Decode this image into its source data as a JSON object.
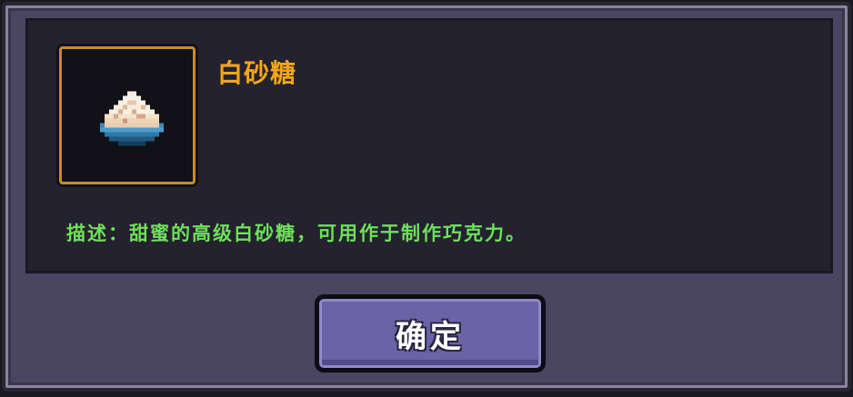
{
  "dialog": {
    "item": {
      "icon": "white-sugar-icon",
      "name": "白砂糖",
      "description": "描述：甜蜜的高级白砂糖，可用作于制作巧克力。"
    },
    "confirm_label": "确定"
  },
  "colors": {
    "item_name": "#f2a61a",
    "description": "#6ee05a",
    "frame_border": "#c88a2e",
    "button": "#6a63a8"
  }
}
